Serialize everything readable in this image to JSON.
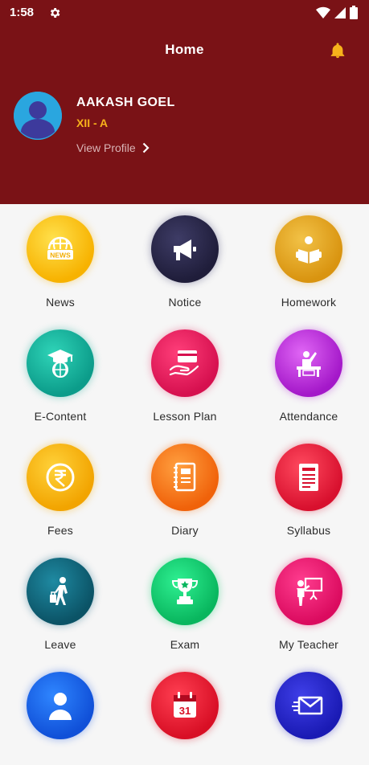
{
  "status_bar": {
    "time": "1:58"
  },
  "header": {
    "title": "Home",
    "user_name": "AAKASH GOEL",
    "user_class": "XII - A",
    "view_profile": "View Profile"
  },
  "menu": {
    "items": [
      {
        "label": "News",
        "icon": "news-globe-icon"
      },
      {
        "label": "Notice",
        "icon": "megaphone-icon"
      },
      {
        "label": "Homework",
        "icon": "reading-student-icon"
      },
      {
        "label": "E-Content",
        "icon": "graduation-globe-icon"
      },
      {
        "label": "Lesson Plan",
        "icon": "card-in-hand-icon"
      },
      {
        "label": "Attendance",
        "icon": "teacher-raising-hand-icon"
      },
      {
        "label": "Fees",
        "icon": "rupee-coin-icon"
      },
      {
        "label": "Diary",
        "icon": "notebook-icon"
      },
      {
        "label": "Syllabus",
        "icon": "document-icon"
      },
      {
        "label": "Leave",
        "icon": "traveler-luggage-icon"
      },
      {
        "label": "Exam",
        "icon": "trophy-icon"
      },
      {
        "label": "My Teacher",
        "icon": "teacher-board-icon"
      },
      {
        "label": "",
        "icon": "person-icon"
      },
      {
        "label": "",
        "icon": "calendar-icon"
      },
      {
        "label": "",
        "icon": "envelope-icon"
      }
    ]
  },
  "colors": {
    "header_bg": "#7a1216",
    "accent": "#f7b21b"
  }
}
